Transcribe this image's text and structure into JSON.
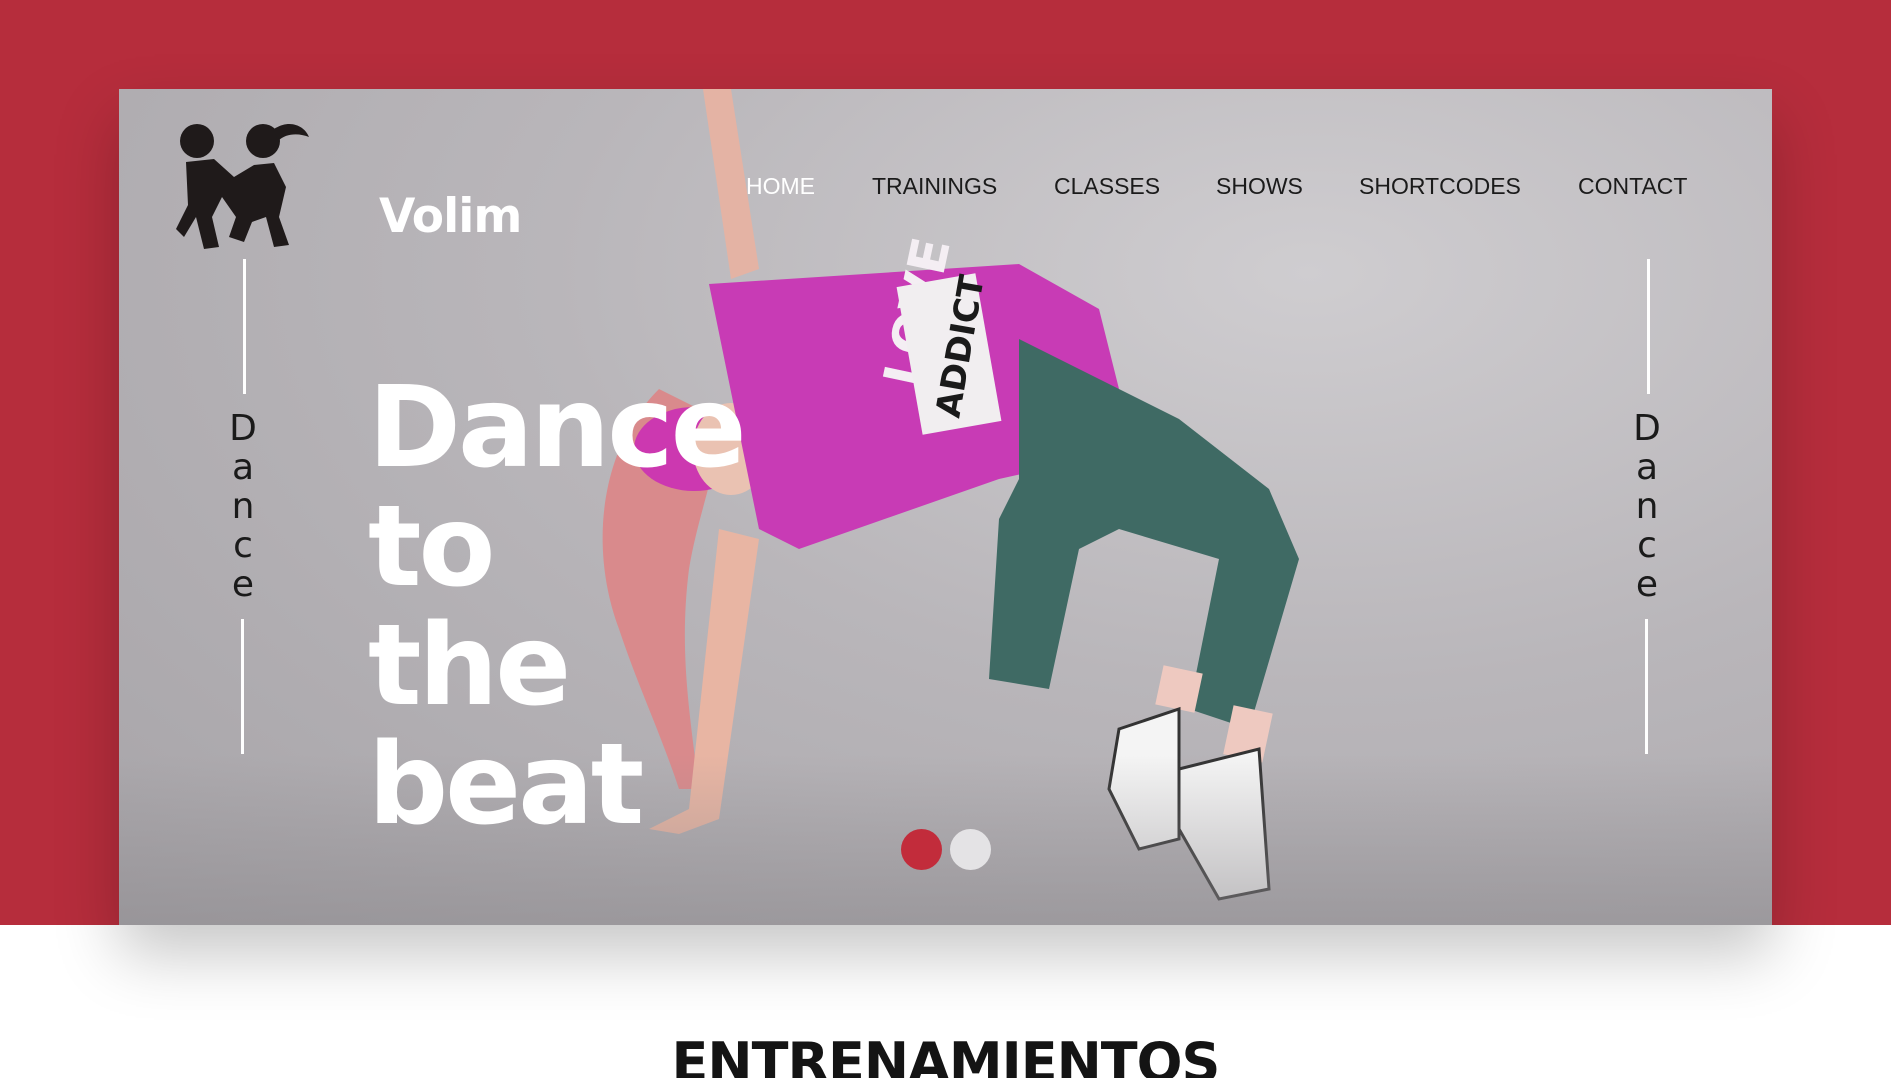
{
  "brand": {
    "name": "Volim",
    "logo_icon": "dancing-couple-icon"
  },
  "nav": {
    "items": [
      {
        "label": "HOME",
        "active": true
      },
      {
        "label": "TRAININGS",
        "active": false
      },
      {
        "label": "CLASSES",
        "active": false
      },
      {
        "label": "SHOWS",
        "active": false
      },
      {
        "label": "SHORTCODES",
        "active": false
      },
      {
        "label": "CONTACT",
        "active": false
      }
    ]
  },
  "hero": {
    "headline": [
      "Dance",
      "to",
      "the",
      "beat"
    ],
    "side_label_left": "Dance",
    "side_label_right": "Dance",
    "slider": {
      "count": 2,
      "active_index": 0
    },
    "background_image": "dancer-photo"
  },
  "sections": {
    "next_title": "ENTRENAMIENTOS"
  },
  "colors": {
    "brand_red": "#b62d3c",
    "dot_active": "#c22c3b",
    "dot_inactive": "#e4e3e5",
    "text_white": "#ffffff"
  }
}
